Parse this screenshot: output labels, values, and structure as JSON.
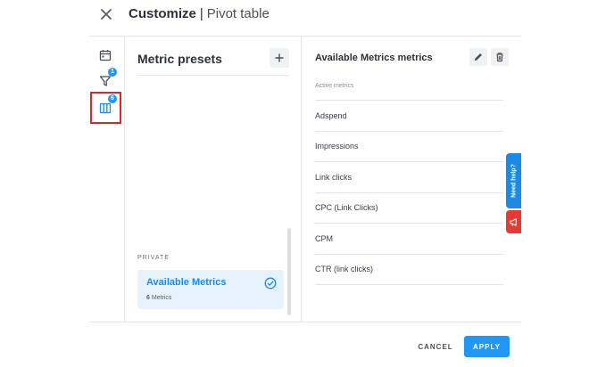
{
  "header": {
    "title": "Customize",
    "separator": "|",
    "subtitle": "Pivot table"
  },
  "rail": {
    "items": [
      {
        "icon": "calendar-icon",
        "badge": null
      },
      {
        "icon": "filter-icon",
        "badge": "1"
      },
      {
        "icon": "columns-icon",
        "badge": "6",
        "selected": true
      }
    ]
  },
  "presets": {
    "title": "Metric presets",
    "section_label": "PRIVATE",
    "items": [
      {
        "name": "Available Metrics",
        "count": "6",
        "count_label": "Metrics",
        "selected": true
      }
    ]
  },
  "metrics": {
    "title": "Available Metrics metrics",
    "list_header": "Active metrics",
    "items": [
      "Adspend",
      "Impressions",
      "Link clicks",
      "CPC (Link Clicks)",
      "CPM",
      "CTR (link clicks)"
    ]
  },
  "side_widgets": {
    "help_label": "Need help?"
  },
  "footer": {
    "cancel_label": "CANCEL",
    "apply_label": "APPLY"
  },
  "colors": {
    "accent": "#2196f3",
    "highlight_outline": "#e02424",
    "announce": "#e53935",
    "selected_bg": "#e6f3fd"
  }
}
